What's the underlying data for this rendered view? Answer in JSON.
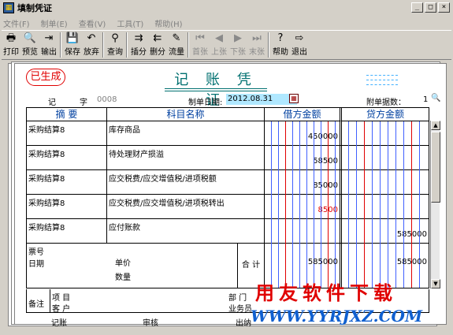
{
  "window": {
    "title": "填制凭证",
    "min": "_",
    "max": "□",
    "close": "×"
  },
  "menu": [
    "文件(F)",
    "制单(E)",
    "查看(V)",
    "工具(T)",
    "帮助(H)"
  ],
  "toolbar": [
    {
      "label": "打印",
      "icon": "printer-icon",
      "glyph": "🖶",
      "enabled": true
    },
    {
      "label": "预览",
      "icon": "preview-icon",
      "glyph": "🔍",
      "enabled": true
    },
    {
      "label": "输出",
      "icon": "export-icon",
      "glyph": "⇥",
      "enabled": true
    },
    {
      "label": "保存",
      "icon": "save-icon",
      "glyph": "💾",
      "enabled": true
    },
    {
      "label": "放弃",
      "icon": "undo-icon",
      "glyph": "↶",
      "enabled": true
    },
    {
      "label": "查询",
      "icon": "binoculars-icon",
      "glyph": "⚲",
      "enabled": true
    },
    {
      "label": "插分",
      "icon": "insert-row-icon",
      "glyph": "⇉",
      "enabled": true
    },
    {
      "label": "删分",
      "icon": "delete-row-icon",
      "glyph": "⇇",
      "enabled": true
    },
    {
      "label": "流量",
      "icon": "cashflow-icon",
      "glyph": "✎",
      "enabled": true
    },
    {
      "label": "首张",
      "icon": "first-icon",
      "glyph": "⏮",
      "enabled": false
    },
    {
      "label": "上张",
      "icon": "prev-icon",
      "glyph": "◀",
      "enabled": false
    },
    {
      "label": "下张",
      "icon": "next-icon",
      "glyph": "▶",
      "enabled": false
    },
    {
      "label": "末张",
      "icon": "last-icon",
      "glyph": "⏭",
      "enabled": false
    },
    {
      "label": "帮助",
      "icon": "help-icon",
      "glyph": "?",
      "enabled": true
    },
    {
      "label": "退出",
      "icon": "exit-icon",
      "glyph": "⇨",
      "enabled": true
    }
  ],
  "voucher": {
    "stamp": "已生成",
    "title": "记 账 凭 证",
    "word_label": "记",
    "word_suffix": "字",
    "number": "0008",
    "date_label": "制单日期:",
    "date": "2012.08.31",
    "attach_label": "附单据数：",
    "attach_count": "1",
    "headers": {
      "summary": "摘 要",
      "account": "科目名称",
      "debit": "借方金额",
      "credit": "贷方金额"
    },
    "rows": [
      {
        "summary": "采购结算8",
        "account": "库存商品",
        "debit": "450000",
        "credit": "",
        "red": false
      },
      {
        "summary": "采购结算8",
        "account": "待处理财产损溢",
        "debit": "58500",
        "credit": "",
        "red": false
      },
      {
        "summary": "采购结算8",
        "account": "应交税费/应交增值税/进项税额",
        "debit": "85000",
        "credit": "",
        "red": false
      },
      {
        "summary": "采购结算8",
        "account": "应交税费/应交增值税/进项税转出",
        "debit": "8500",
        "credit": "",
        "red": true
      },
      {
        "summary": "采购结算8",
        "account": "应付账款",
        "debit": "",
        "credit": "585000",
        "red": false
      }
    ],
    "footer": {
      "ticket_no": "票号",
      "date": "日期",
      "unit_price": "单价",
      "quantity": "数量",
      "total_label": "合 计",
      "debit_total": "585000",
      "credit_total": "585000"
    },
    "remarks": {
      "label": "备注",
      "project": "项 目",
      "customer": "客 户",
      "dept": "部 门",
      "staff": "业务员"
    },
    "signatures": {
      "bookkeeper": "记账",
      "auditor": "审核",
      "cashier": "出纳"
    }
  },
  "watermark": {
    "cn": "用友软件下载",
    "en": "WWW.YYRJXZ.COM"
  }
}
